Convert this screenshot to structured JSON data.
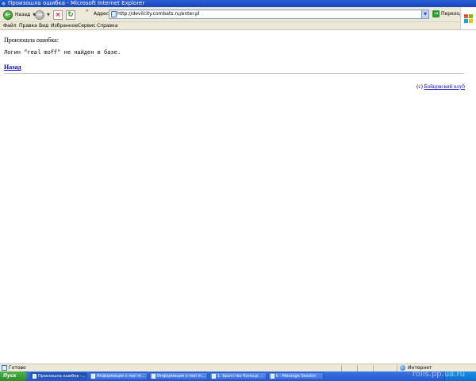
{
  "window": {
    "title": "Произошла ошибка - Microsoft Internet Explorer"
  },
  "toolbar": {
    "back_label": "Назад",
    "address_label": "Адрес:",
    "address_value": "http://devilcity.combats.ru/enter.pl",
    "go_label": "Переход"
  },
  "menu": {
    "items": [
      "Файл",
      "Правка",
      "Вид",
      "Избранное",
      "Сервис",
      "Справка"
    ]
  },
  "content": {
    "error_title": "Произошла ошибка:",
    "error_message": "Логин \"real moff\" не найден в базе.",
    "back_link": "Назад",
    "copyright_prefix": "(c)",
    "copyright_link": "Бойцовский клуб"
  },
  "statusbar": {
    "status": "Готово",
    "zone": "Интернет"
  },
  "taskbar": {
    "start_label": "Пуск",
    "buttons": [
      {
        "label": "Произошла ошибка -..."
      },
      {
        "label": "Информация о real m..."
      },
      {
        "label": "Информация о real m..."
      },
      {
        "label": "1. Братство Кольца ..."
      },
      {
        "label": "k - Message Session"
      }
    ]
  },
  "watermark": "rolls.pp.ua.ru",
  "icons": {
    "back": "back-arrow-icon",
    "forward": "forward-arrow-icon",
    "stop": "stop-icon",
    "refresh": "refresh-icon",
    "go": "go-arrow-icon",
    "status": "page-icon",
    "zone": "internet-globe-icon",
    "logo": "windows-flag-icon"
  },
  "colors": {
    "link": "#0000cc",
    "taskbar": "#245ad1",
    "start": "#2e8c2a"
  }
}
